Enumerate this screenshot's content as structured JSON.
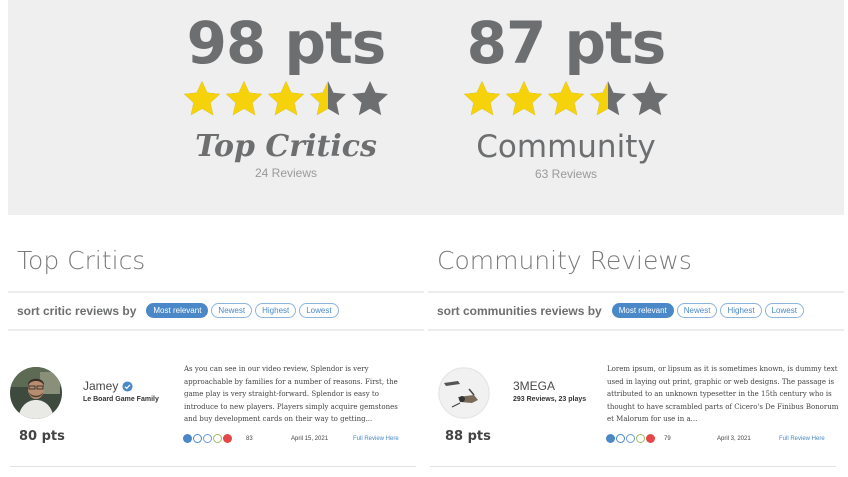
{
  "colors": {
    "star_fill": "#f5d20a",
    "star_empty": "#6c6e70",
    "accent": "#4a88c7",
    "banner_bg": "#efefef"
  },
  "critics_score": {
    "points": "98 pts",
    "star_rating": 3.5,
    "title": "Top Critics",
    "review_count": "24 Reviews"
  },
  "community_score": {
    "points": "87 pts",
    "star_rating": 3.5,
    "title": "Community",
    "review_count": "63 Reviews"
  },
  "critic_section": {
    "title": "Top Critics",
    "sort_label": "sort critic reviews by",
    "sort_options": [
      "Most relevant",
      "Newest",
      "Highest",
      "Lowest"
    ],
    "active_sort": "Most relevant",
    "review": {
      "name": "Jamey",
      "verified": true,
      "affiliation": "Le Board Game Family",
      "points": "80 pts",
      "text": "As you can see in our video review, Splendor is very approachable by families for a number of reasons. First, the game play is very straight-forward. Splendor is easy to introduce to new players. Players simply acquire gemstones and buy development cards on their way to getting...",
      "reaction_icons": [
        "thumbs-up-icon",
        "laugh-icon",
        "wow-icon",
        "lightbulb-icon",
        "heart-icon"
      ],
      "reaction_count": "83",
      "date": "April 15, 2021",
      "link_label": "Full Review Here"
    }
  },
  "community_section": {
    "title": "Community Reviews",
    "sort_label": "sort communities reviews by",
    "sort_options": [
      "Most relevant",
      "Newest",
      "Highest",
      "Lowest"
    ],
    "active_sort": "Most relevant",
    "review": {
      "name": "3MEGA",
      "stats": "293 Reviews, 23 plays",
      "points": "88 pts",
      "text": "Lorem ipsum, or lipsum as it is sometimes known, is dummy text used in laying out print, graphic or web designs. The passage is attributed to an unknown typesetter in the 15th century who is thought to have scrambled parts of Cicero's De Finibus Bonorum et Malorum for use in a...",
      "reaction_icons": [
        "thumbs-up-icon",
        "laugh-icon",
        "wow-icon",
        "lightbulb-icon",
        "heart-icon"
      ],
      "reaction_count": "79",
      "date": "April 3, 2021",
      "link_label": "Full Review Here"
    }
  }
}
